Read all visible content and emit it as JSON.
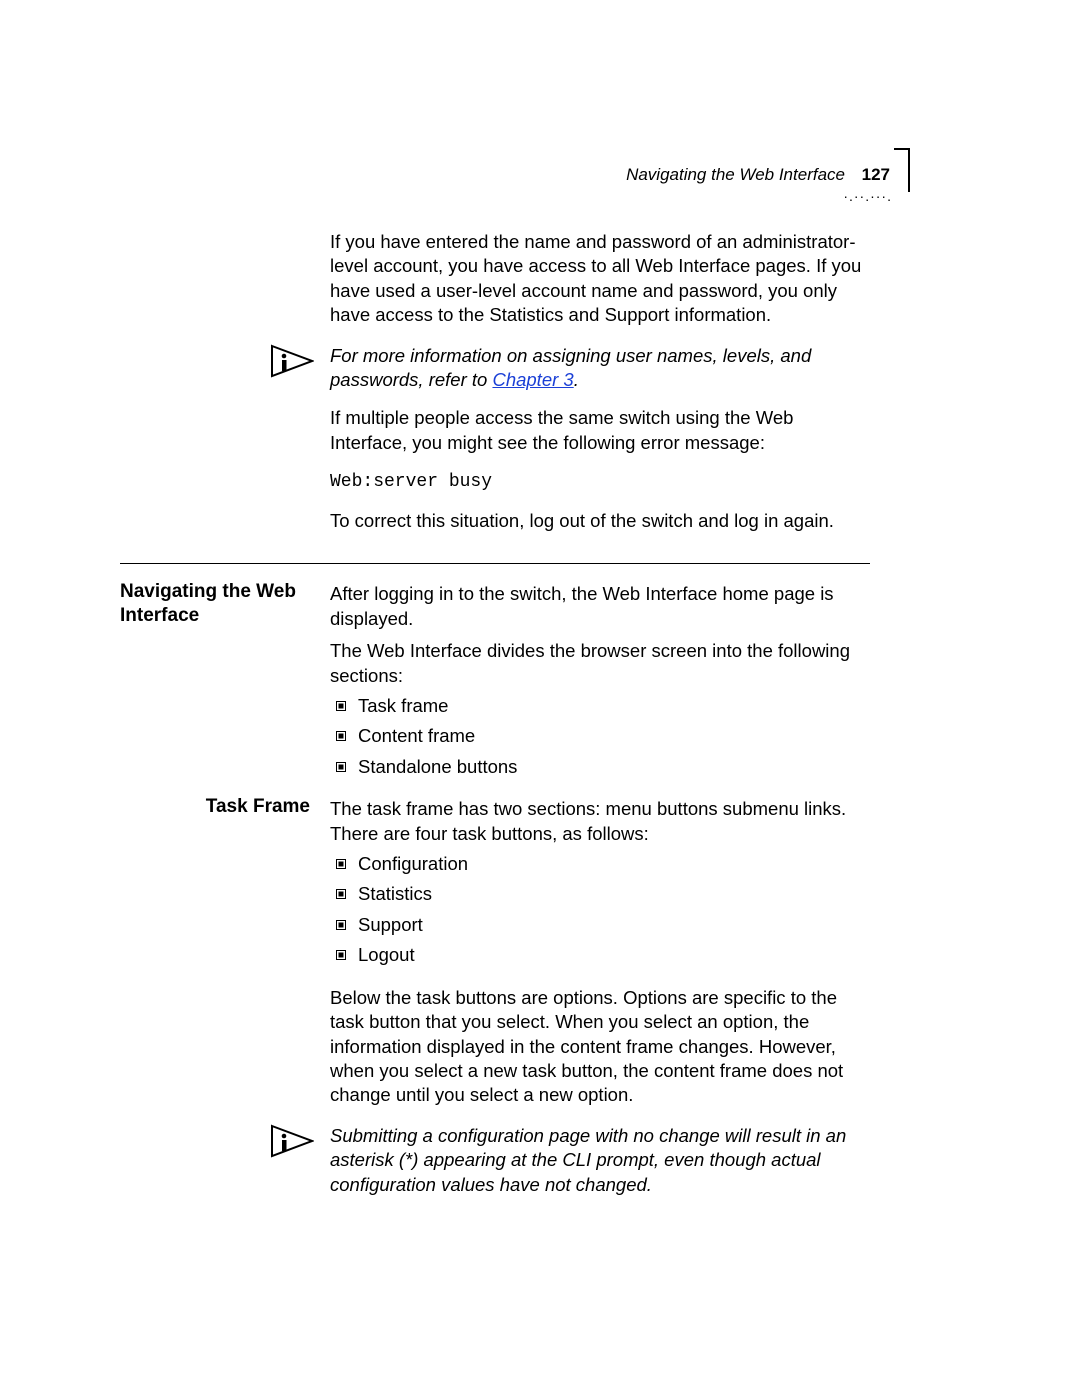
{
  "header": {
    "running_head": "Navigating the Web Interface",
    "page_number": "127",
    "decor": "·.··.···."
  },
  "intro": {
    "p1": "If you have entered the name and password of an administrator-level account, you have access to all Web Interface pages. If you have used a user-level account name and password, you only have access to the Statistics and Support information.",
    "note1_pre": "For more information on assigning user names, levels, and passwords, refer to ",
    "note1_link": "Chapter 3",
    "note1_post": ".",
    "p2": "If multiple people access the same switch using the Web Interface, you might see the following error message:",
    "code": "Web:server busy",
    "p3": "To correct this situation, log out of the switch and log in again."
  },
  "nav_section": {
    "heading": "Navigating the Web Interface",
    "p1": "After logging in to the switch, the Web Interface home page is displayed.",
    "p2": "The Web Interface divides the browser screen into the following sections:",
    "bullets": [
      "Task frame",
      "Content frame",
      "Standalone buttons"
    ]
  },
  "task_frame": {
    "heading": "Task Frame",
    "p1": "The task frame has two sections: menu buttons submenu links. There are four task buttons, as follows:",
    "bullets": [
      "Configuration",
      "Statistics",
      "Support",
      "Logout"
    ],
    "p2": "Below the task buttons are options. Options are specific to the task button that you select. When you select an option, the information displayed in the content frame changes. However, when you select a new task button, the content frame does not change until you select a new option.",
    "note": "Submitting a configuration page with no change will result in an asterisk (*) appearing at the CLI prompt, even though actual configuration values have not changed."
  }
}
